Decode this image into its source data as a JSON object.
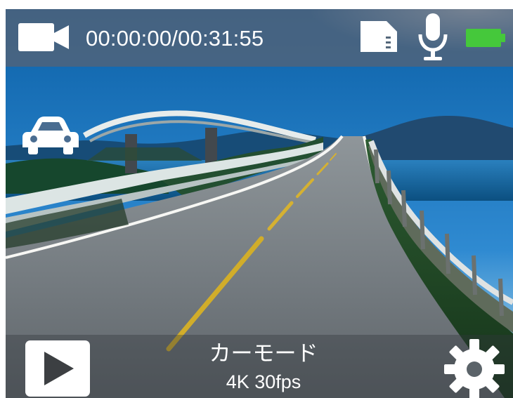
{
  "status_bar": {
    "recording_time": "00:00:00/00:31:55",
    "camera_icon": "video-camera-icon",
    "storage_icon": "sd-card-icon",
    "microphone_icon": "microphone-icon",
    "battery_icon": "battery-full-icon",
    "battery_level": 1.0
  },
  "mode": {
    "icon": "car-icon",
    "name": "カーモード",
    "resolution": "4K 30fps"
  },
  "controls": {
    "playback_icon": "play-icon",
    "settings_icon": "gear-icon"
  },
  "colors": {
    "battery_green": "#45c83b",
    "overlay": "#546376",
    "icon_white": "#ffffff"
  }
}
